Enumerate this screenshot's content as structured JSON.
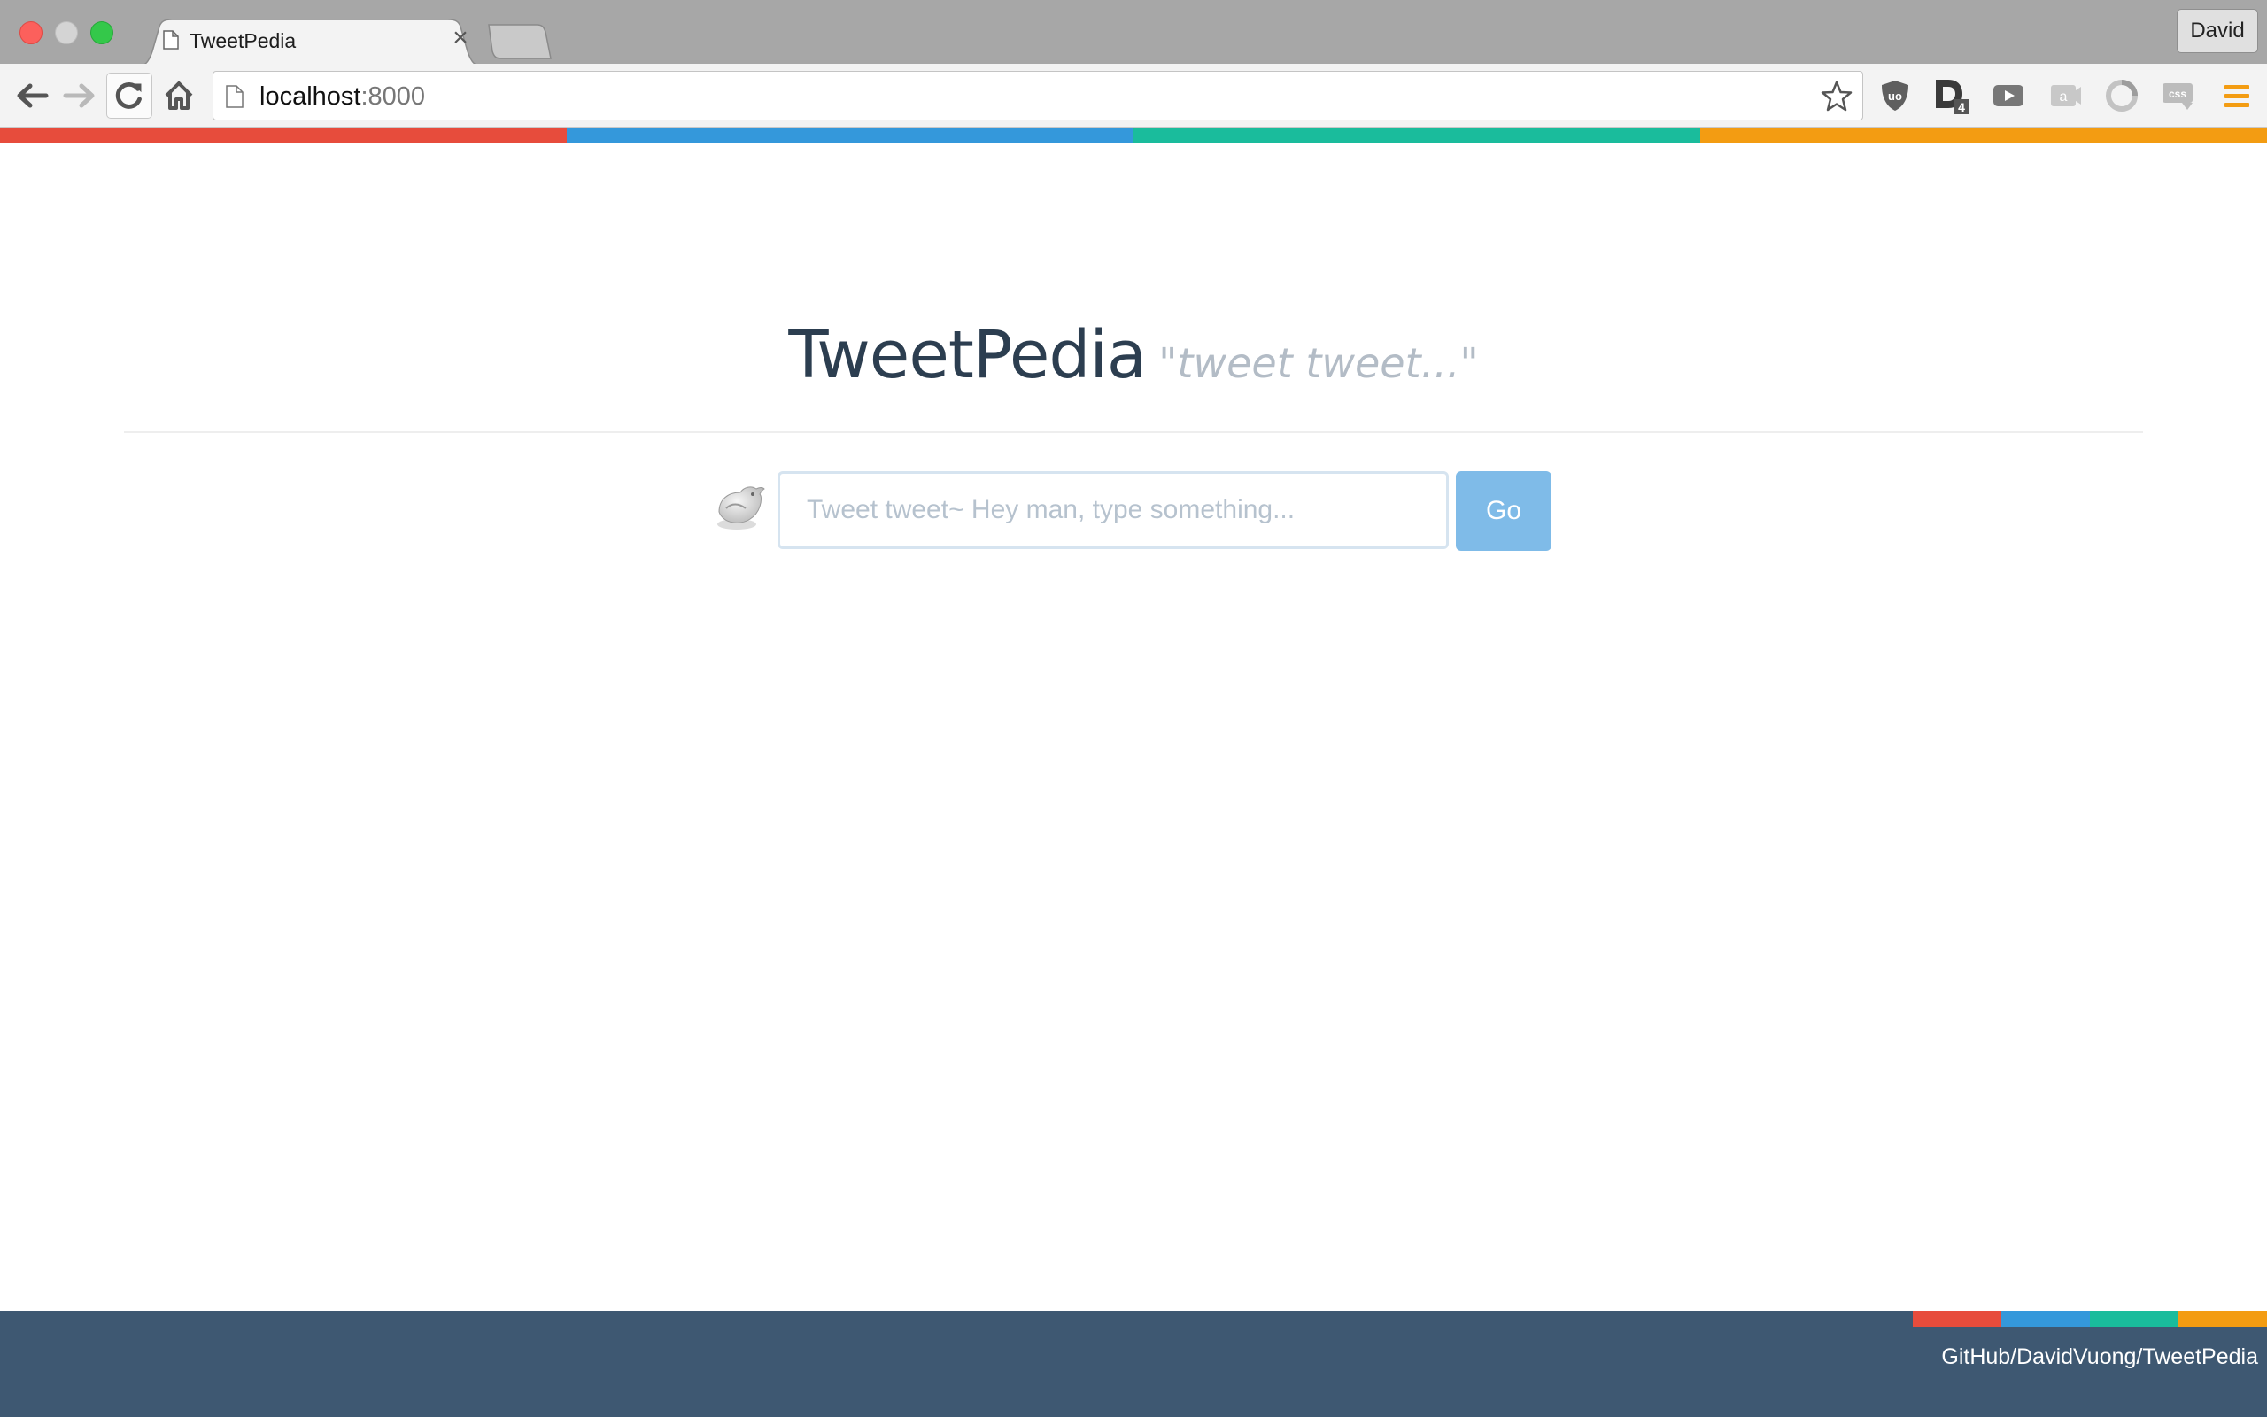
{
  "browser": {
    "tab_title": "TweetPedia",
    "tab_close_glyph": "×",
    "profile_name": "David",
    "url_host": "localhost",
    "url_port": ":8000",
    "extensions": [
      "ublock-icon",
      "d4-icon",
      "video-icon",
      "a-icon",
      "circle-icon",
      "css-icon",
      "menu-icon"
    ]
  },
  "colors": {
    "red": "#e74c3c",
    "blue": "#3498db",
    "teal": "#1abc9c",
    "orange": "#f39c12",
    "title": "#2c3e50",
    "footer": "#3e5872",
    "go_button": "#7fbbe8"
  },
  "header": {
    "title": "TweetPedia",
    "tagline": "\"tweet tweet...\""
  },
  "search": {
    "placeholder": "Tweet tweet~ Hey man, type something...",
    "value": "",
    "button_label": "Go"
  },
  "footer": {
    "link_text": "GitHub/DavidVuong/TweetPedia"
  }
}
